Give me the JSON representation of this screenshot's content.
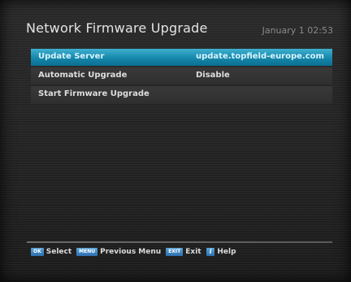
{
  "header": {
    "title": "Network Firmware Upgrade",
    "datetime": "January 1 02:53"
  },
  "menu": {
    "items": [
      {
        "label": "Update Server",
        "value": "update.topfield-europe.com",
        "selected": true
      },
      {
        "label": "Automatic Upgrade",
        "value": "Disable",
        "selected": false
      },
      {
        "label": "Start Firmware Upgrade",
        "value": "",
        "selected": false
      }
    ]
  },
  "footer": {
    "hints": [
      {
        "key": "OK",
        "label": "Select"
      },
      {
        "key": "MENU",
        "label": "Previous Menu"
      },
      {
        "key": "EXIT",
        "label": "Exit"
      },
      {
        "key": "i",
        "label": "Help"
      }
    ]
  },
  "colors": {
    "highlight": "#1587aa",
    "background": "#262626",
    "key_button": "#2d6fb0"
  }
}
